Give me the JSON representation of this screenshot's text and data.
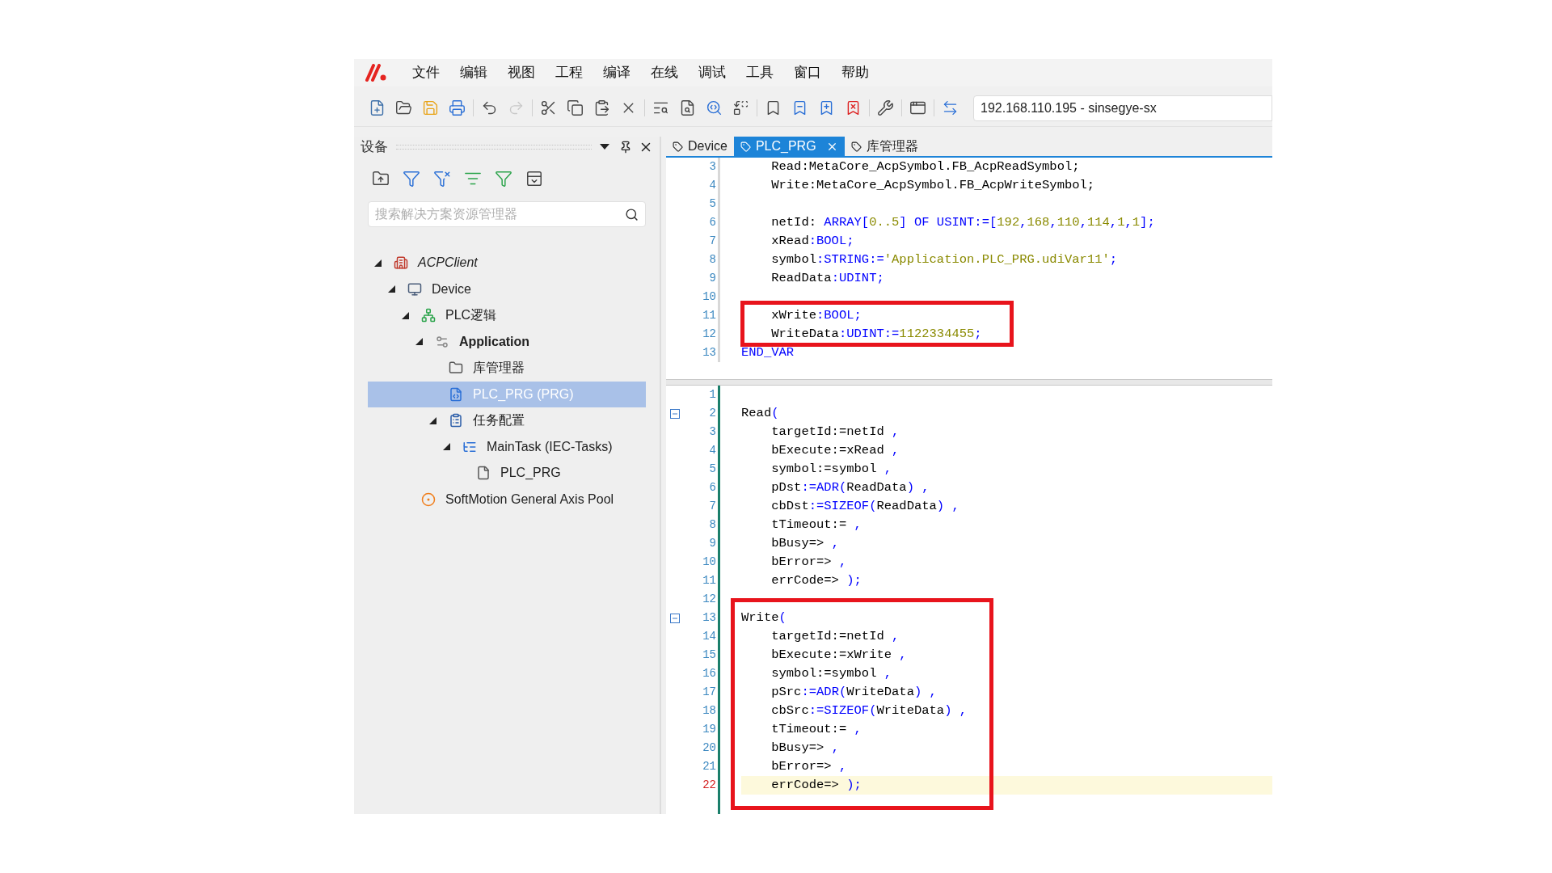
{
  "menu": [
    "文件",
    "编辑",
    "视图",
    "工程",
    "编译",
    "在线",
    "调试",
    "工具",
    "窗口",
    "帮助"
  ],
  "toolbar": {
    "groups": [
      [
        {
          "kind": "new",
          "disabled": false
        },
        {
          "kind": "open",
          "disabled": false
        },
        {
          "kind": "save",
          "disabled": false
        },
        {
          "kind": "print",
          "disabled": false
        }
      ],
      [
        {
          "kind": "undo",
          "disabled": false
        },
        {
          "kind": "redo",
          "disabled": true
        }
      ],
      [
        {
          "kind": "cut",
          "disabled": false
        },
        {
          "kind": "copy",
          "disabled": false
        },
        {
          "kind": "paste",
          "disabled": false
        },
        {
          "kind": "delete",
          "disabled": false
        }
      ],
      [
        {
          "kind": "find",
          "disabled": false
        },
        {
          "kind": "find-file",
          "disabled": false
        },
        {
          "kind": "search-doc",
          "disabled": false
        },
        {
          "kind": "replace",
          "disabled": false
        }
      ],
      [
        {
          "kind": "bookmark",
          "disabled": false
        },
        {
          "kind": "bookmark-prev",
          "disabled": false
        },
        {
          "kind": "bookmark-next",
          "disabled": false
        },
        {
          "kind": "bookmark-clear",
          "disabled": false
        }
      ],
      [
        {
          "kind": "tools",
          "disabled": false
        }
      ],
      [
        {
          "kind": "window",
          "disabled": false
        }
      ],
      [
        {
          "kind": "connection",
          "disabled": false
        }
      ]
    ],
    "connection": "192.168.110.195 - sinsegye-sx"
  },
  "devices_panel": {
    "title": "设备",
    "search": {
      "placeholder": "搜索解决方案资源管理器"
    },
    "tree": [
      {
        "label": "ACPClient",
        "kind": "project",
        "expanded": true,
        "selected": false,
        "children": [
          {
            "label": "Device",
            "kind": "device",
            "expanded": true,
            "selected": false,
            "children": [
              {
                "label": "PLC逻辑",
                "kind": "plc-logic",
                "expanded": true,
                "selected": false,
                "children": [
                  {
                    "label": "Application",
                    "kind": "application",
                    "expanded": true,
                    "selected": false,
                    "children": [
                      {
                        "label": "库管理器",
                        "kind": "folder",
                        "selected": false
                      },
                      {
                        "label": "PLC_PRG (PRG)",
                        "kind": "program",
                        "selected": true
                      },
                      {
                        "label": "任务配置",
                        "kind": "task-config",
                        "expanded": true,
                        "selected": false,
                        "children": [
                          {
                            "label": "MainTask (IEC-Tasks)",
                            "kind": "task",
                            "expanded": true,
                            "selected": false,
                            "children": [
                              {
                                "label": "PLC_PRG",
                                "kind": "pou",
                                "selected": false
                              }
                            ]
                          }
                        ]
                      }
                    ]
                  }
                ]
              },
              {
                "label": "SoftMotion General Axis Pool",
                "kind": "axis-pool",
                "selected": false
              }
            ]
          }
        ]
      }
    ]
  },
  "tabs": [
    {
      "label": "Device",
      "selected": false
    },
    {
      "label": "PLC_PRG",
      "selected": true
    },
    {
      "label": "库管理器",
      "selected": false
    }
  ],
  "declaration": {
    "blocks": [
      {
        "framed": false,
        "lines": [
          {
            "number": "3",
            "tokens": [
              {
                "text": "    Read:MetaCore_AcpSymbol.FB_AcpReadSymbol;",
                "kind": "plain"
              }
            ]
          },
          {
            "number": "4",
            "tokens": [
              {
                "text": "    Write:MetaCore_AcpSymbol.FB_AcpWriteSymbol;",
                "kind": "plain"
              }
            ]
          },
          {
            "number": "5"
          },
          {
            "number": "6",
            "tokens": [
              {
                "text": "    netId: ",
                "kind": "plain"
              },
              {
                "text": "ARRAY[",
                "kind": "keyword"
              },
              {
                "text": "0..5",
                "kind": "literal"
              },
              {
                "text": "] OF USINT:=[",
                "kind": "keyword"
              },
              {
                "text": "192",
                "kind": "literal"
              },
              {
                "text": ",",
                "kind": "keyword"
              },
              {
                "text": "168",
                "kind": "literal"
              },
              {
                "text": ",",
                "kind": "keyword"
              },
              {
                "text": "110",
                "kind": "literal"
              },
              {
                "text": ",",
                "kind": "keyword"
              },
              {
                "text": "114",
                "kind": "literal"
              },
              {
                "text": ",",
                "kind": "keyword"
              },
              {
                "text": "1",
                "kind": "literal"
              },
              {
                "text": ",",
                "kind": "keyword"
              },
              {
                "text": "1",
                "kind": "literal"
              },
              {
                "text": "];",
                "kind": "keyword"
              }
            ]
          },
          {
            "number": "7",
            "tokens": [
              {
                "text": "    xRead",
                "kind": "plain"
              },
              {
                "text": ":BOOL;",
                "kind": "keyword"
              }
            ]
          },
          {
            "number": "8",
            "tokens": [
              {
                "text": "    symbol",
                "kind": "plain"
              },
              {
                "text": ":STRING:=",
                "kind": "keyword"
              },
              {
                "text": "'Application.PLC_PRG.udiVar11'",
                "kind": "literal"
              },
              {
                "text": ";",
                "kind": "keyword"
              }
            ]
          },
          {
            "number": "9",
            "tokens": [
              {
                "text": "    ReadData",
                "kind": "plain"
              },
              {
                "text": ":UDINT;",
                "kind": "keyword"
              }
            ]
          },
          {
            "number": "10"
          }
        ]
      },
      {
        "framed": true,
        "lines": [
          {
            "number": "11",
            "tokens": [
              {
                "text": "    xWrite",
                "kind": "plain"
              },
              {
                "text": ":BOOL;",
                "kind": "keyword"
              }
            ]
          },
          {
            "number": "12",
            "tokens": [
              {
                "text": "    WriteData",
                "kind": "plain"
              },
              {
                "text": ":UDINT:=",
                "kind": "keyword"
              },
              {
                "text": "1122334455",
                "kind": "literal"
              },
              {
                "text": ";",
                "kind": "keyword"
              }
            ]
          }
        ]
      },
      {
        "framed": false,
        "lines": [
          {
            "number": "13",
            "tokens": [
              {
                "text": "END_VAR",
                "kind": "keyword"
              }
            ]
          }
        ]
      }
    ]
  },
  "implementation": {
    "blocks": [
      {
        "framed": false,
        "lines": [
          {
            "number": "1"
          },
          {
            "number": "2",
            "foldable": true,
            "tokens": [
              {
                "text": "Read",
                "kind": "plain"
              },
              {
                "text": "(",
                "kind": "keyword"
              }
            ]
          },
          {
            "number": "3",
            "tokens": [
              {
                "text": "    targetId:=netId ",
                "kind": "plain"
              },
              {
                "text": ",",
                "kind": "keyword"
              }
            ]
          },
          {
            "number": "4",
            "tokens": [
              {
                "text": "    bExecute:=xRead ",
                "kind": "plain"
              },
              {
                "text": ",",
                "kind": "keyword"
              }
            ]
          },
          {
            "number": "5",
            "tokens": [
              {
                "text": "    symbol:=symbol ",
                "kind": "plain"
              },
              {
                "text": ",",
                "kind": "keyword"
              }
            ]
          },
          {
            "number": "6",
            "tokens": [
              {
                "text": "    pDst",
                "kind": "plain"
              },
              {
                "text": ":=ADR(",
                "kind": "keyword"
              },
              {
                "text": "ReadData",
                "kind": "plain"
              },
              {
                "text": ") ,",
                "kind": "keyword"
              }
            ]
          },
          {
            "number": "7",
            "tokens": [
              {
                "text": "    cbDst",
                "kind": "plain"
              },
              {
                "text": ":=SIZEOF(",
                "kind": "keyword"
              },
              {
                "text": "ReadData",
                "kind": "plain"
              },
              {
                "text": ") ,",
                "kind": "keyword"
              }
            ]
          },
          {
            "number": "8",
            "tokens": [
              {
                "text": "    tTimeout:= ",
                "kind": "plain"
              },
              {
                "text": ",",
                "kind": "keyword"
              }
            ]
          },
          {
            "number": "9",
            "tokens": [
              {
                "text": "    bBusy=> ",
                "kind": "plain"
              },
              {
                "text": ",",
                "kind": "keyword"
              }
            ]
          },
          {
            "number": "10",
            "tokens": [
              {
                "text": "    bError=> ",
                "kind": "plain"
              },
              {
                "text": ",",
                "kind": "keyword"
              }
            ]
          },
          {
            "number": "11",
            "tokens": [
              {
                "text": "    errCode=> ",
                "kind": "plain"
              },
              {
                "text": ");",
                "kind": "keyword"
              }
            ]
          },
          {
            "number": "12"
          }
        ]
      },
      {
        "framed": true,
        "lines": [
          {
            "number": "13",
            "foldable": true,
            "tokens": [
              {
                "text": "Write",
                "kind": "plain"
              },
              {
                "text": "(",
                "kind": "keyword"
              }
            ]
          },
          {
            "number": "14",
            "tokens": [
              {
                "text": "    targetId:=netId ",
                "kind": "plain"
              },
              {
                "text": ",",
                "kind": "keyword"
              }
            ]
          },
          {
            "number": "15",
            "tokens": [
              {
                "text": "    bExecute:=xWrite ",
                "kind": "plain"
              },
              {
                "text": ",",
                "kind": "keyword"
              }
            ]
          },
          {
            "number": "16",
            "tokens": [
              {
                "text": "    symbol:=symbol ",
                "kind": "plain"
              },
              {
                "text": ",",
                "kind": "keyword"
              }
            ]
          },
          {
            "number": "17",
            "tokens": [
              {
                "text": "    pSrc",
                "kind": "plain"
              },
              {
                "text": ":=ADR(",
                "kind": "keyword"
              },
              {
                "text": "WriteData",
                "kind": "plain"
              },
              {
                "text": ") ,",
                "kind": "keyword"
              }
            ]
          },
          {
            "number": "18",
            "tokens": [
              {
                "text": "    cbSrc",
                "kind": "plain"
              },
              {
                "text": ":=SIZEOF(",
                "kind": "keyword"
              },
              {
                "text": "WriteData",
                "kind": "plain"
              },
              {
                "text": ") ,",
                "kind": "keyword"
              }
            ]
          },
          {
            "number": "19",
            "tokens": [
              {
                "text": "    tTimeout:= ",
                "kind": "plain"
              },
              {
                "text": ",",
                "kind": "keyword"
              }
            ]
          },
          {
            "number": "20",
            "tokens": [
              {
                "text": "    bBusy=> ",
                "kind": "plain"
              },
              {
                "text": ",",
                "kind": "keyword"
              }
            ]
          },
          {
            "number": "21",
            "tokens": [
              {
                "text": "    bError=> ",
                "kind": "plain"
              },
              {
                "text": ",",
                "kind": "keyword"
              }
            ]
          },
          {
            "number": "22",
            "current": true,
            "tokens": [
              {
                "text": "    errCode=> ",
                "kind": "plain"
              },
              {
                "text": ");",
                "kind": "keyword"
              }
            ]
          }
        ]
      }
    ]
  }
}
